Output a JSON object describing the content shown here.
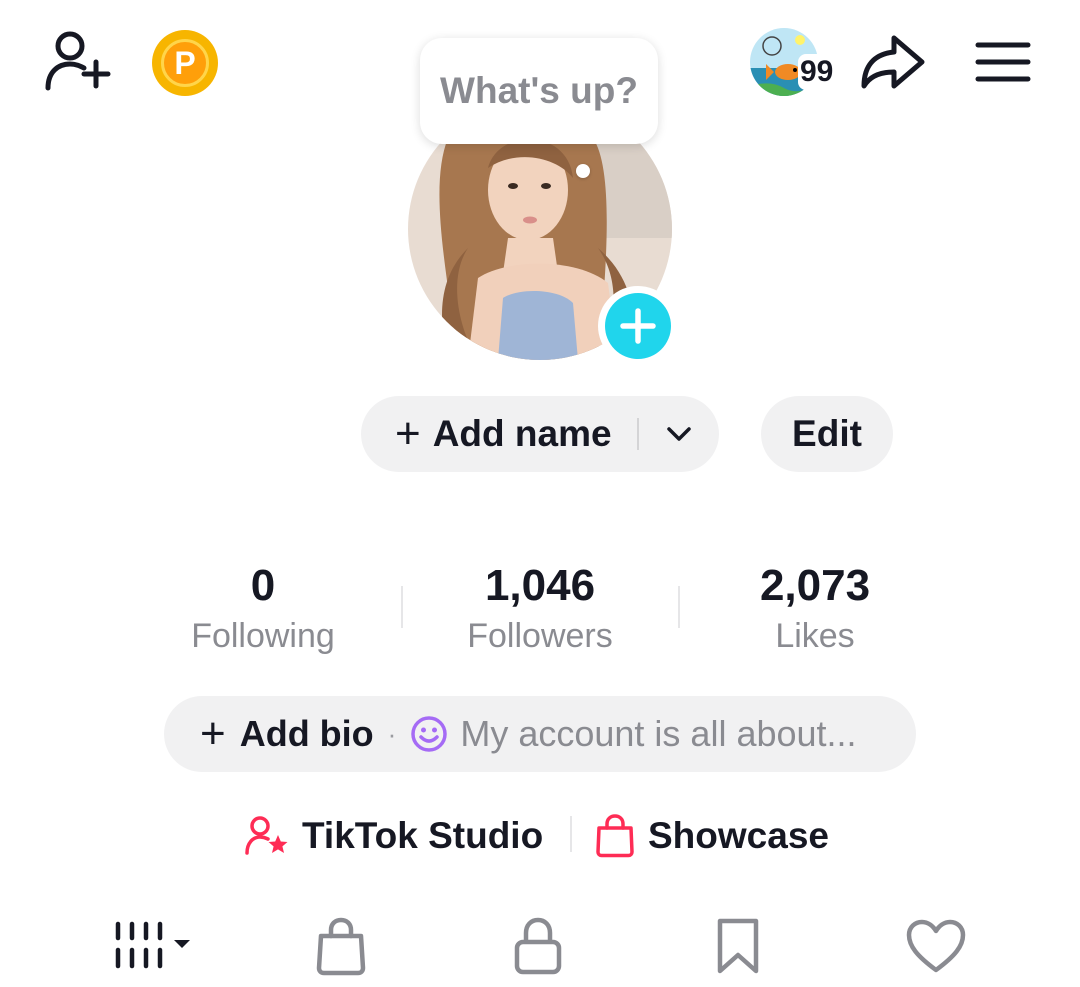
{
  "header": {
    "coin_letter": "P",
    "notification_count": "99"
  },
  "status_bubble": {
    "text": "What's up?"
  },
  "profile": {
    "add_name_label": "Add name",
    "edit_label": "Edit"
  },
  "stats": [
    {
      "value": "0",
      "label": "Following"
    },
    {
      "value": "1,046",
      "label": "Followers"
    },
    {
      "value": "2,073",
      "label": "Likes"
    }
  ],
  "bio": {
    "add_label": "Add bio",
    "separator": "·",
    "placeholder": "My account is all about..."
  },
  "links": {
    "studio_label": "TikTok Studio",
    "showcase_label": "Showcase"
  },
  "tabs": [
    {
      "icon": "grid-icon"
    },
    {
      "icon": "shopping-bag-icon"
    },
    {
      "icon": "lock-icon"
    },
    {
      "icon": "bookmark-icon"
    },
    {
      "icon": "heart-icon"
    }
  ],
  "colors": {
    "accent_cyan": "#20d5ec",
    "accent_red": "#fe2c55",
    "coin": "#f7b500",
    "pill_bg": "#f1f1f2",
    "muted_text": "#8a8b91",
    "bio_emoji": "#a56bf5"
  }
}
